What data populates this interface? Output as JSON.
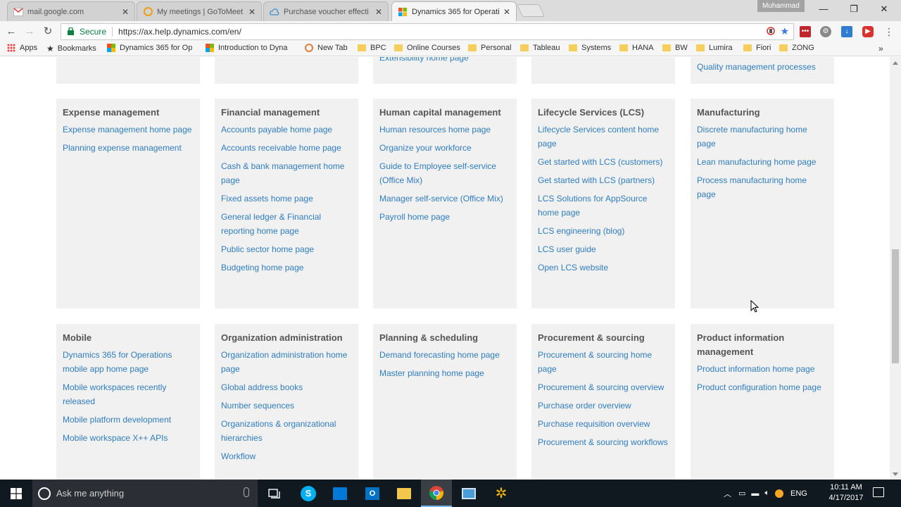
{
  "browser": {
    "tabs": [
      {
        "title": "mail.google.com",
        "icon": "gmail-icon",
        "active": false
      },
      {
        "title": "My meetings | GoToMeet",
        "icon": "gotomeeting-icon",
        "active": false
      },
      {
        "title": "Purchase voucher effecti",
        "icon": "cloud-icon",
        "active": false
      },
      {
        "title": "Dynamics 365 for Operati",
        "icon": "microsoft-icon",
        "active": true
      }
    ],
    "profile_name": "Muhammad",
    "secure_label": "Secure",
    "url": "https://ax.help.dynamics.com/en/",
    "bookmarks": [
      {
        "label": "Apps",
        "icon": "apps-grid-icon"
      },
      {
        "label": "Bookmarks",
        "icon": "star-icon"
      },
      {
        "label": "Dynamics 365 for Op",
        "icon": "microsoft-icon"
      },
      {
        "label": "Introduction to Dyna",
        "icon": "microsoft-icon"
      },
      {
        "label": "New Tab",
        "icon": "globe-icon"
      },
      {
        "label": "BPC",
        "icon": "folder-icon"
      },
      {
        "label": "Online Courses",
        "icon": "folder-icon"
      },
      {
        "label": "Personal",
        "icon": "folder-icon"
      },
      {
        "label": "Tableau",
        "icon": "folder-icon"
      },
      {
        "label": "Systems",
        "icon": "folder-icon"
      },
      {
        "label": "HANA",
        "icon": "folder-icon"
      },
      {
        "label": "BW",
        "icon": "folder-icon"
      },
      {
        "label": "Lumira",
        "icon": "folder-icon"
      },
      {
        "label": "Fiori",
        "icon": "folder-icon"
      },
      {
        "label": "ZONG",
        "icon": "folder-icon"
      }
    ],
    "bookmarks_more": "»"
  },
  "page": {
    "top_partial": {
      "col3_link": "Extensibility home page",
      "col5_link": "Quality management processes"
    },
    "row1": [
      {
        "heading": "Expense management",
        "links": [
          "Expense management home page",
          "Planning expense management"
        ]
      },
      {
        "heading": "Financial management",
        "links": [
          "Accounts payable home page",
          "Accounts receivable home page",
          "Cash & bank management home page",
          "Fixed assets home page",
          "General ledger & Financial reporting home page",
          "Public sector home page",
          "Budgeting home page"
        ]
      },
      {
        "heading": "Human capital management",
        "links": [
          "Human resources home page",
          "Organize your workforce",
          "Guide to Employee self-service (Office Mix)",
          "Manager self-service (Office Mix)",
          "Payroll home page"
        ]
      },
      {
        "heading": "Lifecycle Services (LCS)",
        "links": [
          "Lifecycle Services content home page",
          "Get started with LCS (customers)",
          "Get started with LCS (partners)",
          "LCS Solutions for AppSource home page",
          "LCS engineering (blog)",
          "LCS user guide",
          "Open LCS website"
        ]
      },
      {
        "heading": "Manufacturing",
        "links": [
          "Discrete manufacturing home page",
          "Lean manufacturing home page",
          "Process manufacturing home page"
        ]
      }
    ],
    "row2": [
      {
        "heading": "Mobile",
        "links": [
          "Dynamics 365 for Operations mobile app home page",
          "Mobile workspaces recently released",
          "Mobile platform development",
          "Mobile workspace X++ APIs"
        ]
      },
      {
        "heading": "Organization administration",
        "links": [
          "Organization administration home page",
          "Global address books",
          "Number sequences",
          "Organizations & organizational hierarchies",
          "Workflow"
        ]
      },
      {
        "heading": "Planning & scheduling",
        "links": [
          "Demand forecasting home page",
          "Master planning home page"
        ]
      },
      {
        "heading": "Procurement & sourcing",
        "links": [
          "Procurement & sourcing home page",
          "Procurement & sourcing overview",
          "Purchase order overview",
          "Purchase requisition overview",
          "Procurement & sourcing workflows"
        ]
      },
      {
        "heading": "Product information management",
        "links": [
          "Product information home page",
          "Product configuration home page"
        ]
      }
    ]
  },
  "taskbar": {
    "search_placeholder": "Ask me anything",
    "language": "ENG",
    "time": "10:11 AM",
    "date": "4/17/2017"
  },
  "colors": {
    "link": "#2f7dbf",
    "card_bg": "#f1f1f1",
    "heading": "#555555",
    "taskbar_bg": "#101820"
  }
}
